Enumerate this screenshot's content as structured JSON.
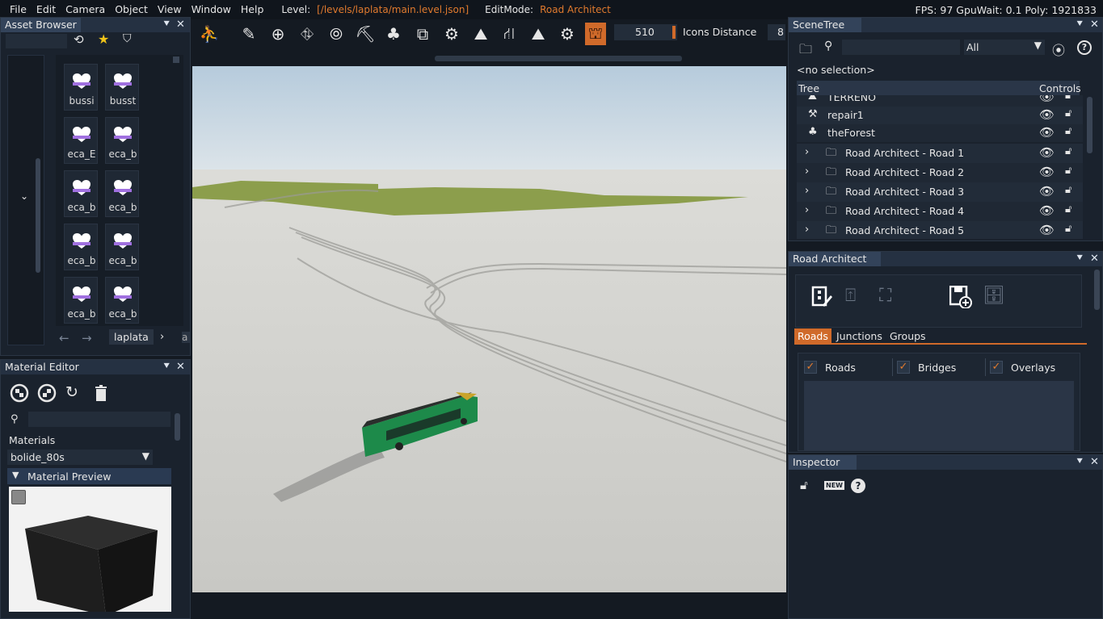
{
  "menubar": {
    "items": [
      "File",
      "Edit",
      "Camera",
      "Object",
      "View",
      "Window",
      "Help"
    ],
    "level_label": "Level:",
    "level_path": "[/levels/laplata/main.level.json]",
    "editmode_label": "EditMode:",
    "editmode_value": "Road Architect",
    "stats": "FPS: 97  GpuWait: 0.1  Poly: 1921833"
  },
  "toolbar": {
    "number_value": "510",
    "icons_distance_label": "Icons Distance",
    "icons_distance_value": "8"
  },
  "asset_browser": {
    "title": "Asset Browser",
    "tiles": [
      "bussi",
      "busst",
      "eca_E",
      "eca_b",
      "eca_b",
      "eca_b",
      "eca_b",
      "eca_b",
      "eca_b",
      "eca_b"
    ],
    "breadcrumb": "laplata",
    "breadcrumb_next": "a"
  },
  "material_editor": {
    "title": "Material Editor",
    "materials_label": "Materials",
    "selected_material": "bolide_80s",
    "preview_label": "Material Preview"
  },
  "scene_tree": {
    "title": "SceneTree",
    "filter_value": "All",
    "selection": "<no selection>",
    "col_tree": "Tree",
    "col_controls": "Controls",
    "rows": [
      {
        "name": "TERRENO",
        "expandable": false,
        "icon": "terrain-icon"
      },
      {
        "name": "repair1",
        "expandable": false,
        "icon": "repair-icon"
      },
      {
        "name": "theForest",
        "expandable": false,
        "icon": "forest-icon"
      },
      {
        "name": "Road Architect - Road 1",
        "expandable": true,
        "icon": "folder-icon"
      },
      {
        "name": "Road Architect - Road 2",
        "expandable": true,
        "icon": "folder-icon"
      },
      {
        "name": "Road Architect - Road 3",
        "expandable": true,
        "icon": "folder-icon"
      },
      {
        "name": "Road Architect - Road 4",
        "expandable": true,
        "icon": "folder-icon"
      },
      {
        "name": "Road Architect - Road 5",
        "expandable": true,
        "icon": "folder-icon"
      }
    ]
  },
  "road_architect": {
    "title": "Road Architect",
    "tabs": [
      "Roads",
      "Junctions",
      "Groups"
    ],
    "active_tab": "Roads",
    "checkboxes": [
      "Roads",
      "Bridges",
      "Overlays"
    ]
  },
  "inspector": {
    "title": "Inspector",
    "new_badge": "NEW"
  },
  "colors": {
    "accent": "#e07a2e",
    "panel_bg": "#1a222d",
    "title_bg": "#253142",
    "heart": "#ffffff",
    "heart_band": "#a070e0"
  }
}
